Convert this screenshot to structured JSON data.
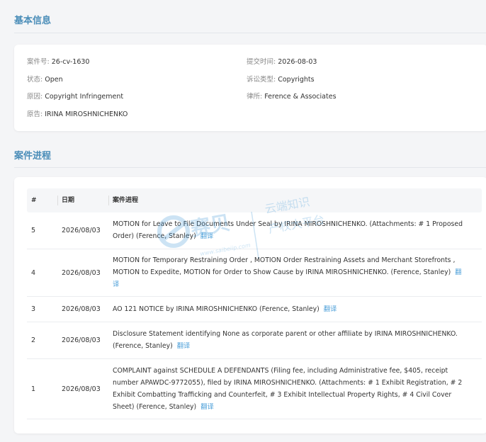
{
  "basic_info": {
    "title": "基本信息",
    "case_no": {
      "label": "案件号:",
      "value": "26-cv-1630"
    },
    "filed_date": {
      "label": "提交时间:",
      "value": "2026-08-03"
    },
    "status": {
      "label": "状态:",
      "value": "Open"
    },
    "suit_type": {
      "label": "诉讼类型:",
      "value": "Copyrights"
    },
    "cause": {
      "label": "原因:",
      "value": "Copyright Infringement"
    },
    "law_firm": {
      "label": "律所:",
      "value": "Ference & Associates"
    },
    "plaintiff": {
      "label": "原告:",
      "value": "IRINA MIROSHNICHENKO"
    }
  },
  "progress": {
    "title": "案件进程",
    "columns": [
      "#",
      "日期",
      "案件进程"
    ],
    "translate_label": "翻译",
    "rows": [
      {
        "num": "5",
        "date": "2026/08/03",
        "text": "MOTION for Leave to File Documents Under Seal by IRINA MIROSHNICHENKO. (Attachments: # 1 Proposed Order) (Ference, Stanley)"
      },
      {
        "num": "4",
        "date": "2026/08/03",
        "text": "MOTION for Temporary Restraining Order , MOTION Order Restraining Assets and Merchant Storefronts , MOTION to Expedite, MOTION for Order to Show Cause by IRINA MIROSHNICHENKO. (Ference, Stanley)"
      },
      {
        "num": "3",
        "date": "2026/08/03",
        "text": "AO 121 NOTICE by IRINA MIROSHNICHENKO (Ference, Stanley)"
      },
      {
        "num": "2",
        "date": "2026/08/03",
        "text": "Disclosure Statement identifying None as corporate parent or other affiliate by IRINA MIROSHNICHENKO. (Ference, Stanley)"
      },
      {
        "num": "1",
        "date": "2026/08/03",
        "text": "COMPLAINT against SCHEDULE A DEFENDANTS (Filing fee, including Administrative fee, $405, receipt number APAWDC-9772055), filed by IRINA MIROSHNICHENKO. (Attachments: # 1 Exhibit Registration, # 2 Exhibit Combatting Trafficking and Counterfeit, # 3 Exhibit Intellectual Property Rights, # 4 Civil Cover Sheet) (Ference, Stanley)"
      }
    ]
  },
  "watermark": {
    "brand": "赛贝",
    "slogan_1": "云端知识",
    "slogan_2": "产权大平台",
    "url": "www.saibeiip.com"
  },
  "colors": {
    "accent": "#4a8db8",
    "link": "#4a9ed8"
  }
}
